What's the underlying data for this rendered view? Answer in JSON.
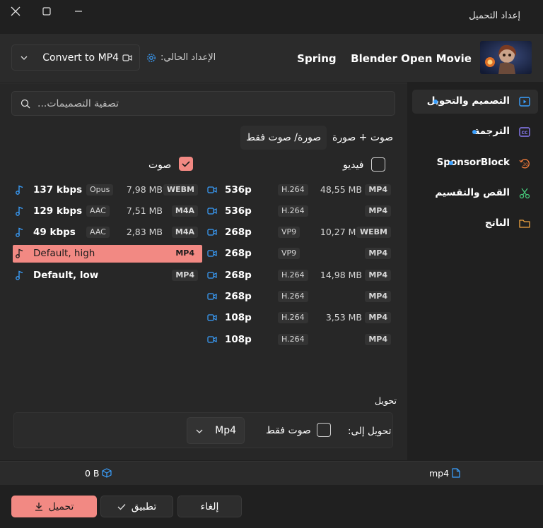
{
  "window": {
    "title": "إعداد التحميل"
  },
  "header": {
    "video_title": "Blender Open Movie",
    "video_sub": "Spring",
    "preset_label": "الإعداد الحالي:",
    "preset_value": "Convert to MP4"
  },
  "filter": {
    "placeholder": "تصفية التصميمات..."
  },
  "tabs": [
    {
      "label": "صوت + صورة"
    },
    {
      "label": "صورة/ صوت فقط"
    }
  ],
  "sections": {
    "video_label": "فيديو",
    "audio_label": "صوت"
  },
  "video_rows": [
    {
      "quality": "536p",
      "codec": "H.264",
      "size": "48,55 MB",
      "container": "MP4"
    },
    {
      "quality": "536p",
      "codec": "H.264",
      "size": "",
      "container": "MP4"
    },
    {
      "quality": "268p",
      "codec": "VP9",
      "size": "10,27 MB",
      "container": "WEBM"
    },
    {
      "quality": "268p",
      "codec": "VP9",
      "size": "",
      "container": "MP4"
    },
    {
      "quality": "268p",
      "codec": "H.264",
      "size": "14,98 MB",
      "container": "MP4"
    },
    {
      "quality": "268p",
      "codec": "H.264",
      "size": "",
      "container": "MP4"
    },
    {
      "quality": "108p",
      "codec": "H.264",
      "size": "3,53 MB",
      "container": "MP4"
    },
    {
      "quality": "108p",
      "codec": "H.264",
      "size": "",
      "container": "MP4"
    }
  ],
  "audio_rows": [
    {
      "quality": "137 kbps",
      "codec": "Opus",
      "size": "7,98 MB",
      "container": "WEBM"
    },
    {
      "quality": "129 kbps",
      "codec": "AAC",
      "size": "7,51 MB",
      "container": "M4A"
    },
    {
      "quality": "49 kbps",
      "codec": "AAC",
      "size": "2,83 MB",
      "container": "M4A"
    },
    {
      "quality": "Default, high",
      "codec": "",
      "size": "",
      "container": "MP4",
      "selected": true
    },
    {
      "quality": "Default, low",
      "codec": "",
      "size": "",
      "container": "MP4"
    }
  ],
  "convert": {
    "heading": "تحويل",
    "to_label": "تحويل إلى:",
    "audio_only_label": "صوت فقط",
    "format": "Mp4"
  },
  "sidebar": {
    "items": [
      {
        "label": "التصميم والتحويل",
        "icon": "video-player-icon",
        "color": "#3aa0ff",
        "dot": true
      },
      {
        "label": "الترجمة",
        "icon": "closed-captions-icon",
        "color": "#8a7cf6",
        "dot": true
      },
      {
        "label": "SponsorBlock",
        "icon": "skip-30-icon",
        "color": "#ef7a3a",
        "dot": true
      },
      {
        "label": "القص والتقسيم",
        "icon": "scissors-icon",
        "color": "#46c97a",
        "dot": false
      },
      {
        "label": "الناتج",
        "icon": "folder-icon",
        "color": "#f2a540",
        "dot": false
      }
    ]
  },
  "status": {
    "size": "0 B",
    "format": "mp4"
  },
  "footer": {
    "download": "تحميل",
    "apply": "تطبيق",
    "cancel": "إلغاء"
  },
  "colors": {
    "accent": "#f28983",
    "link": "#3aa0ff",
    "background": "#202020"
  }
}
